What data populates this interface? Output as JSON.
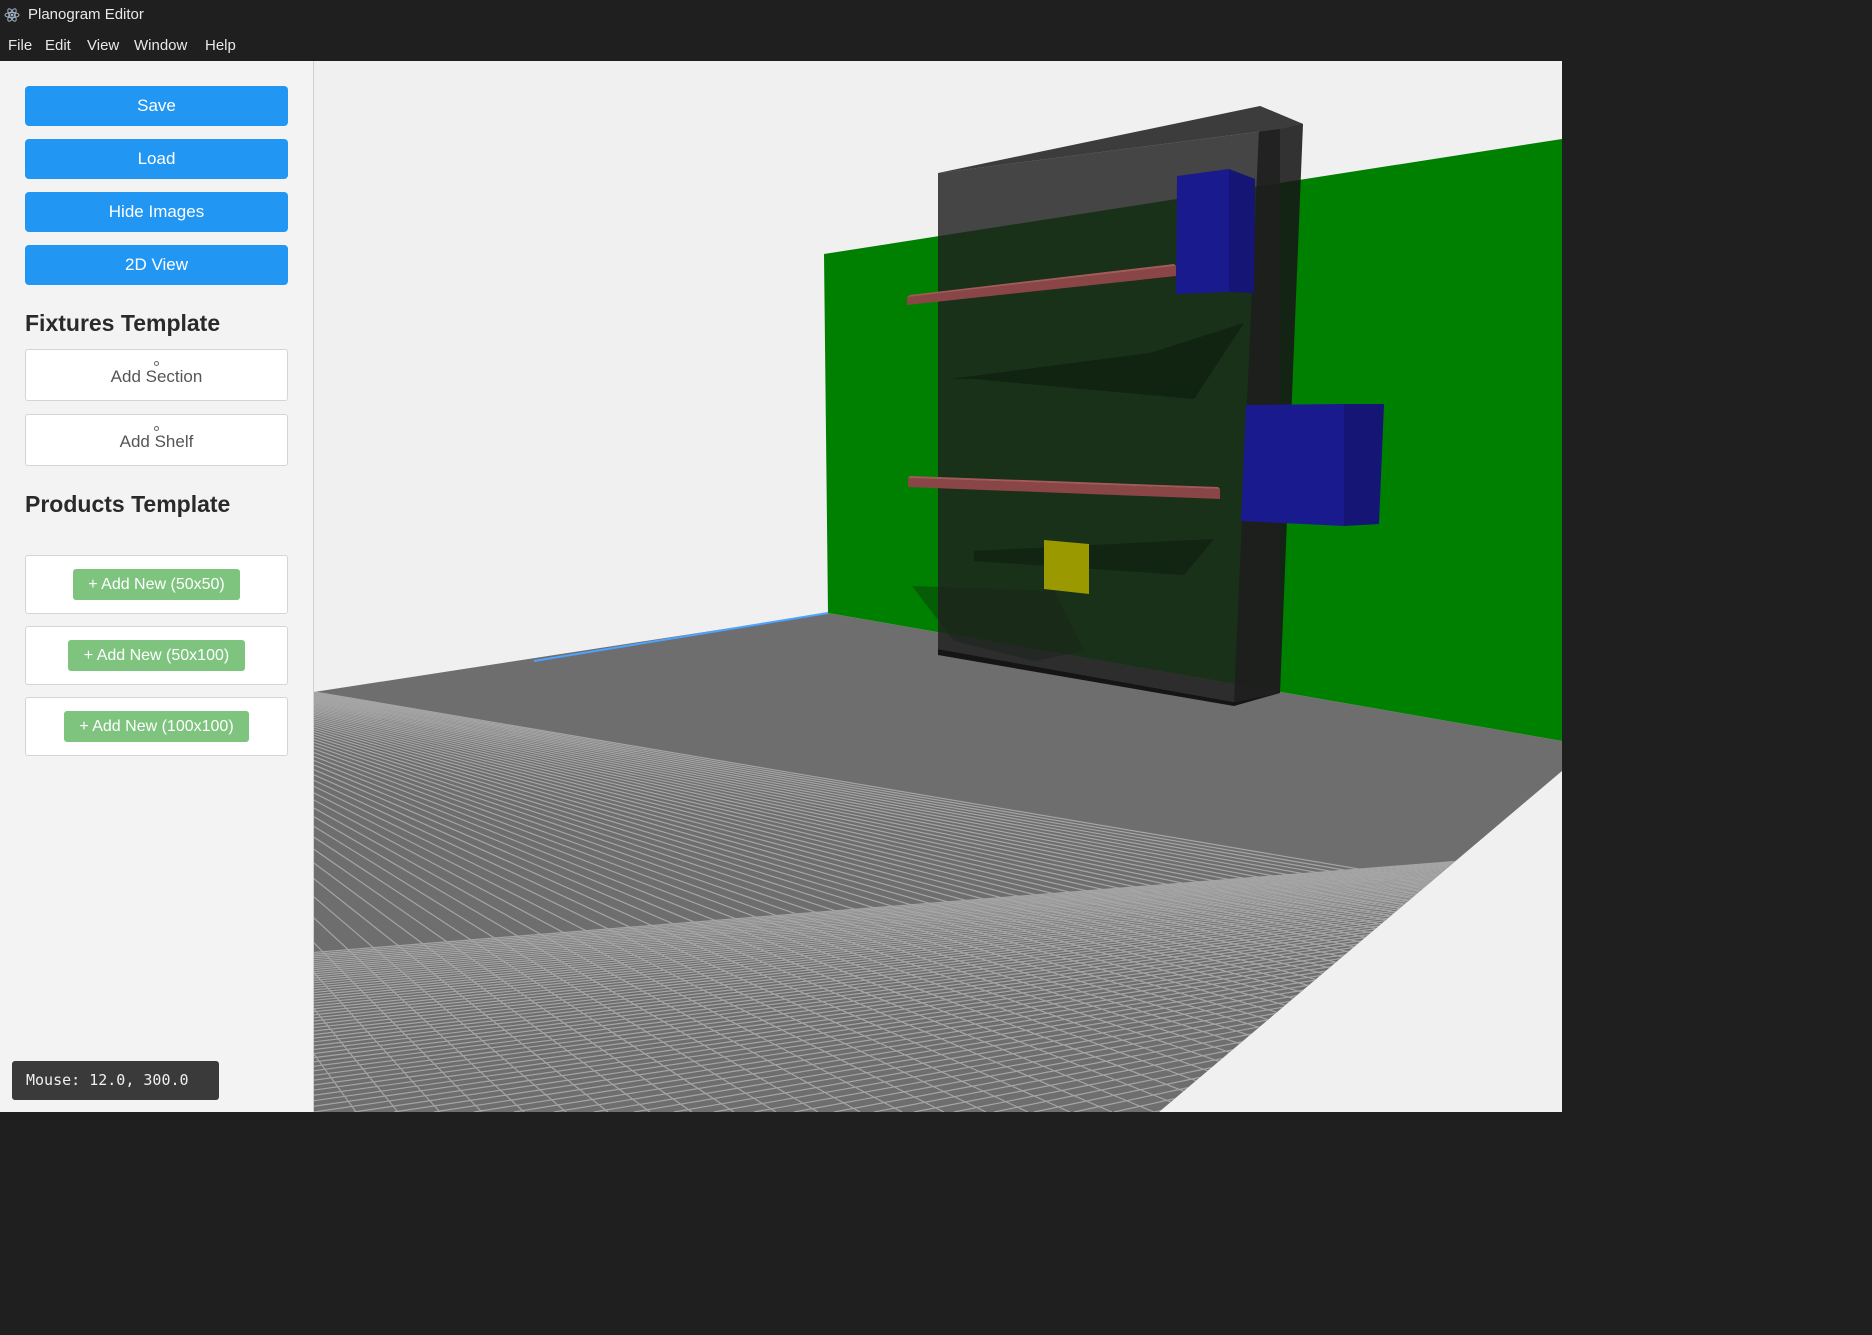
{
  "window": {
    "title": "Planogram Editor",
    "icon": "electron-atom-icon"
  },
  "menu": [
    "File",
    "Edit",
    "View",
    "Window",
    "Help"
  ],
  "sidebar": {
    "actions": {
      "save": "Save",
      "load": "Load",
      "hide_images": "Hide Images",
      "view_2d": "2D View"
    },
    "fixtures_title": "Fixtures Template",
    "fixtures": {
      "add_section": "Add Section",
      "add_shelf": "Add Shelf"
    },
    "products_title": "Products Template",
    "products": [
      "+ Add New (50x50)",
      "+ Add New (50x100)",
      "+ Add New (100x100)"
    ]
  },
  "status": {
    "mouse": "Mouse: 12.0, 300.0"
  },
  "colors": {
    "accent_blue": "#2196f3",
    "product_green": "#7ec47f",
    "wall": "#008000",
    "floor": "#6e6e6e",
    "fixture": "#1e1e1e",
    "shelf": "#8a4646",
    "product_box_blue": "#1a1a8f",
    "product_box_yellow": "#9a9a00"
  }
}
